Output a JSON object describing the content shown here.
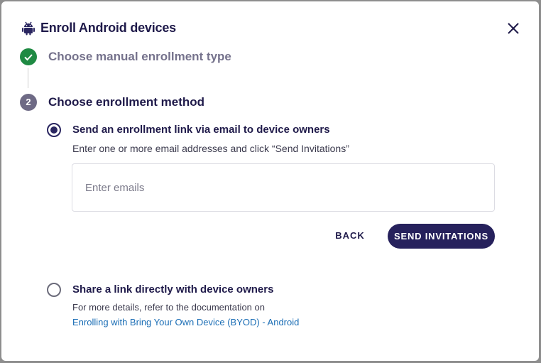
{
  "dialog": {
    "title": "Enroll Android devices",
    "header_icon": "android-icon",
    "close_icon": "close-icon"
  },
  "steps": [
    {
      "label": "Choose manual enrollment type",
      "status": "completed",
      "icon": "check-icon"
    },
    {
      "label": "Choose enrollment method",
      "status": "active",
      "number": "2"
    }
  ],
  "options": {
    "email": {
      "title": "Send an enrollment link via email to device owners",
      "description": "Enter one or more email addresses and click “Send Invitations”",
      "selected": true,
      "input_value": "",
      "input_placeholder": "Enter emails"
    },
    "share": {
      "title": "Share a link directly with device owners",
      "description": "For more details, refer to the documentation on",
      "link_text": "Enrolling with Bring Your Own Device (BYOD) - Android",
      "selected": false
    }
  },
  "actions": {
    "back_label": "BACK",
    "send_label": "SEND INVITATIONS"
  },
  "colors": {
    "primary": "#26215c",
    "success": "#1f8a43",
    "link": "#1a6db5"
  }
}
